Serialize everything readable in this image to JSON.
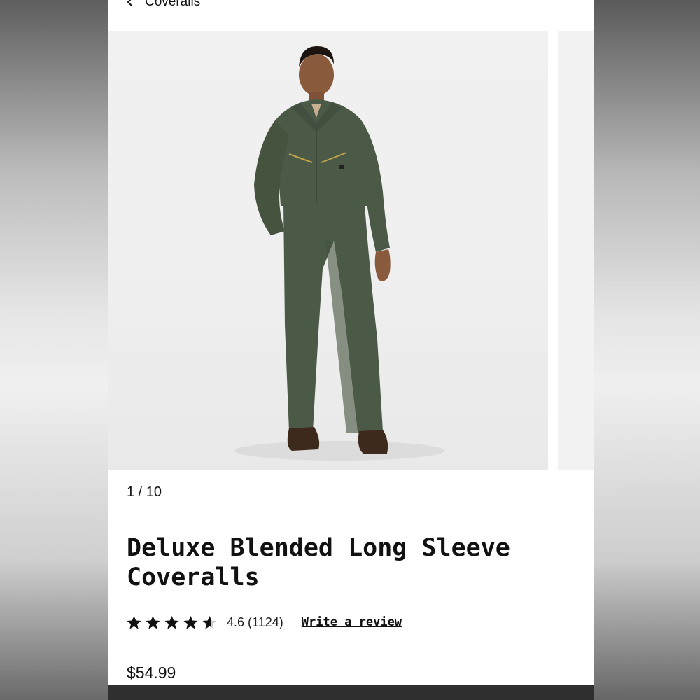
{
  "nav": {
    "back_label": "Coveralls"
  },
  "gallery": {
    "counter": "1 / 10"
  },
  "product": {
    "title": "Deluxe Blended Long Sleeve Coveralls",
    "rating": "4.6",
    "review_count": "(1124)",
    "stars": 4.6,
    "write_review_label": "Write a review",
    "price": "$54.99"
  },
  "icons": {
    "back": "chevron-left-icon",
    "star": "star-icon"
  },
  "colors": {
    "coverall_green": "#4b5a46",
    "text": "#111111",
    "bottom_bar": "#2f2f2f"
  }
}
